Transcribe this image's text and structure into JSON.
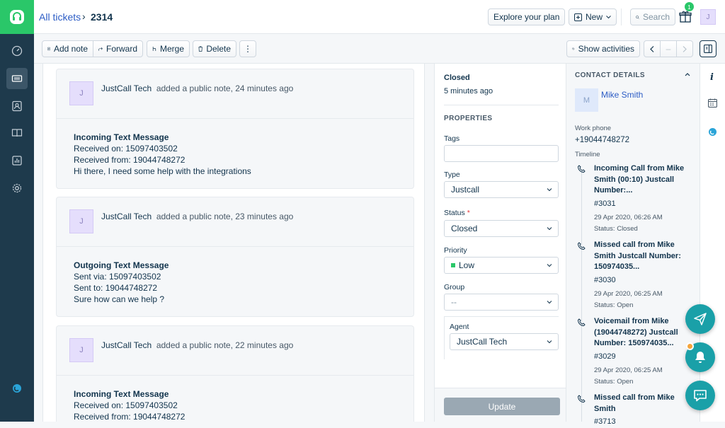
{
  "header": {
    "breadcrumb_link": "All tickets",
    "ticket_id": "2314",
    "explore_label": "Explore your plan",
    "new_label": "New",
    "search_label": "Search",
    "gift_badge": "1",
    "user_initial": "J"
  },
  "toolbar": {
    "add_note": "Add note",
    "forward": "Forward",
    "merge": "Merge",
    "delete": "Delete",
    "more": "⋮",
    "show_activities": "Show activities"
  },
  "notes": [
    {
      "initial": "J",
      "author": "JustCall Tech",
      "action": "added a public note, 24 minutes ago",
      "title": "Incoming Text Message",
      "lines": [
        "Received on: 15097403502",
        "Received from: 19044748272",
        "Hi there, I need some help with the integrations"
      ]
    },
    {
      "initial": "J",
      "author": "JustCall Tech",
      "action": "added a public note, 23 minutes ago",
      "title": "Outgoing Text Message",
      "lines": [
        "Sent via: 15097403502",
        "Sent to: 19044748272",
        "Sure how can we help ?"
      ]
    },
    {
      "initial": "J",
      "author": "JustCall Tech",
      "action": "added a public note, 22 minutes ago",
      "title": "Incoming Text Message",
      "lines": [
        "Received on: 15097403502",
        "Received from: 19044748272"
      ]
    }
  ],
  "properties": {
    "status_title": "Closed",
    "status_time": "5 minutes ago",
    "heading": "PROPERTIES",
    "tags_label": "Tags",
    "type_label": "Type",
    "type_value": "Justcall",
    "status_label": "Status",
    "status_required": "*",
    "status_value": "Closed",
    "priority_label": "Priority",
    "priority_value": "Low",
    "priority_color": "#2ac769",
    "group_label": "Group",
    "group_value": "--",
    "agent_label": "Agent",
    "agent_value": "JustCall Tech",
    "update_label": "Update"
  },
  "contact": {
    "heading": "CONTACT DETAILS",
    "initial": "M",
    "name": "Mike Smith",
    "phone_label": "Work phone",
    "phone": "+19044748272",
    "timeline_label": "Timeline",
    "timeline": [
      {
        "title": "Incoming Call from Mike Smith (00:10) Justcall Number:...",
        "ticket": "#3031",
        "time": "29 Apr 2020, 06:26 AM",
        "status": "Status: Closed"
      },
      {
        "title": "Missed call from Mike Smith Justcall Number: 150974035...",
        "ticket": "#3030",
        "time": "29 Apr 2020, 06:25 AM",
        "status": "Status: Open"
      },
      {
        "title": "Voicemail from Mike (19044748272) Justcall Number: 150974035...",
        "ticket": "#3029",
        "time": "29 Apr 2020, 06:25 AM",
        "status": "Status: Open"
      },
      {
        "title": "Missed call from Mike Smith",
        "ticket": "#3713"
      }
    ]
  }
}
